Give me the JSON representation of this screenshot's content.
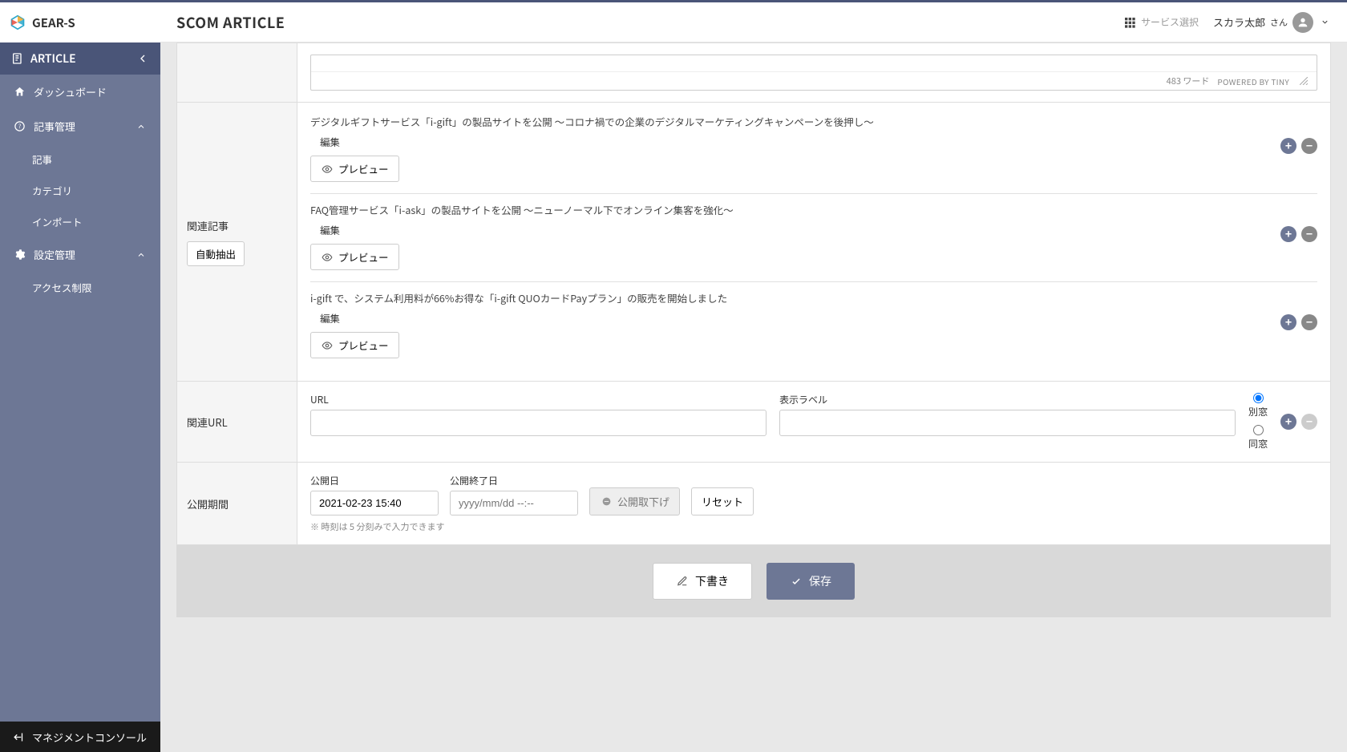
{
  "brand": "GEAR-S",
  "page_title": "SCOM ARTICLE",
  "topbar": {
    "service_select": "サービス選択",
    "user_name": "スカラ太郎",
    "user_suffix": "さん"
  },
  "sidebar": {
    "section_title": "ARTICLE",
    "items": [
      {
        "label": "ダッシュボード",
        "icon": "home"
      },
      {
        "label": "記事管理",
        "icon": "help",
        "expanded": true,
        "children": [
          {
            "label": "記事"
          },
          {
            "label": "カテゴリ"
          },
          {
            "label": "インポート"
          }
        ]
      },
      {
        "label": "設定管理",
        "icon": "gear",
        "expanded": true,
        "children": [
          {
            "label": "アクセス制限"
          }
        ]
      }
    ],
    "footer": "マネジメントコンソール"
  },
  "editor": {
    "word_count_label": "483 ワード",
    "powered_by": "POWERED BY TINY"
  },
  "related_articles": {
    "row_label": "関連記事",
    "auto_extract": "自動抽出",
    "edit_label": "編集",
    "preview_label": "プレビュー",
    "items": [
      {
        "title": "デジタルギフトサービス「i-gift」の製品サイトを公開 ～コロナ禍での企業のデジタルマーケティングキャンペーンを後押し～"
      },
      {
        "title": "FAQ管理サービス「i-ask」の製品サイトを公開 ～ニューノーマル下でオンライン集客を強化～"
      },
      {
        "title": "i-gift で、システム利用料が66%お得な「i-gift QUOカードPayプラン」の販売を開始しました"
      }
    ]
  },
  "related_url": {
    "row_label": "関連URL",
    "url_label": "URL",
    "display_label": "表示ラベル",
    "target_new": "別窓",
    "target_same": "同窓"
  },
  "publish": {
    "row_label": "公開期間",
    "start_label": "公開日",
    "end_label": "公開終了日",
    "start_value": "2021-02-23 15:40",
    "end_placeholder": "yyyy/mm/dd --:--",
    "unpublish": "公開取下げ",
    "reset": "リセット",
    "note": "※ 時刻は 5 分刻みで入力できます"
  },
  "actions": {
    "draft": "下書き",
    "save": "保存"
  }
}
